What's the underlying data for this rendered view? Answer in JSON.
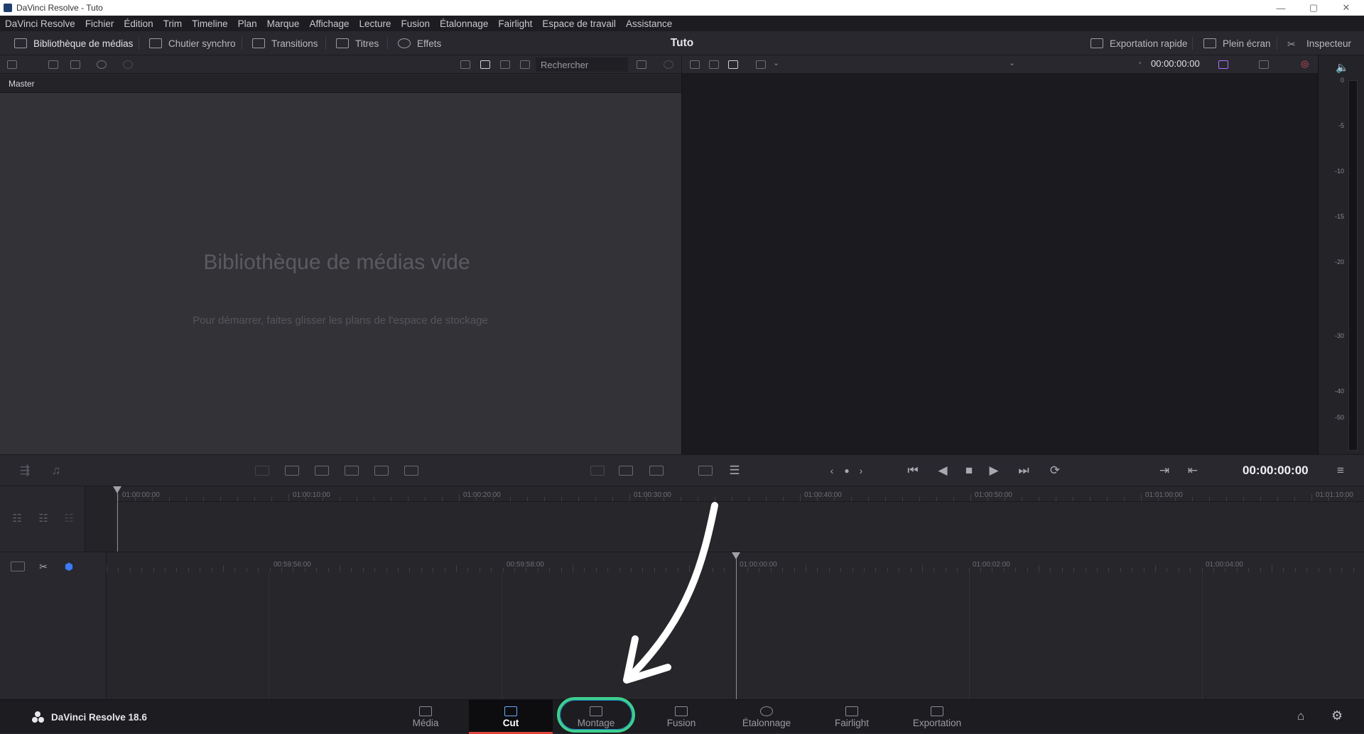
{
  "window": {
    "title": "DaVinci Resolve - Tuto",
    "minimize": "—",
    "maximize": "▢",
    "close": "✕"
  },
  "menu": [
    "DaVinci Resolve",
    "Fichier",
    "Édition",
    "Trim",
    "Timeline",
    "Plan",
    "Marque",
    "Affichage",
    "Lecture",
    "Fusion",
    "Étalonnage",
    "Fairlight",
    "Espace de travail",
    "Assistance"
  ],
  "toolbar": {
    "media_library": "Bibliothèque de médias",
    "sync_bin": "Chutier synchro",
    "transitions": "Transitions",
    "titles": "Titres",
    "effects": "Effets",
    "project_title": "Tuto",
    "quick_export": "Exportation rapide",
    "fullscreen": "Plein écran",
    "inspector": "Inspecteur"
  },
  "media_pool": {
    "search_placeholder": "Rechercher",
    "bin": "Master",
    "empty_title": "Bibliothèque de médias vide",
    "empty_subtitle": "Pour démarrer, faites glisser les plans de l'espace de stockage"
  },
  "viewer": {
    "timecode_top": "00:00:00:00",
    "timecode_main": "00:00:00:00"
  },
  "meter": {
    "labels": [
      "0",
      "-5",
      "-10",
      "-15",
      "-20",
      "-30",
      "-40",
      "-50"
    ]
  },
  "timeline_upper": {
    "ruler": [
      "01:00:00:00",
      "01:00:10:00",
      "01:00:20:00",
      "01:00:30:00",
      "01:00:40:00",
      "01:00:50:00",
      "01:01:00:00",
      "01:01:10:00"
    ]
  },
  "timeline_lower": {
    "ruler": [
      "00:59:56:00",
      "00:59:58:00",
      "01:00:00:00",
      "01:00:02:00",
      "01:00:04:00"
    ]
  },
  "pagebar": {
    "brand": "DaVinci Resolve 18.6",
    "tabs": [
      "Média",
      "Cut",
      "Montage",
      "Fusion",
      "Étalonnage",
      "Fairlight",
      "Exportation"
    ],
    "active_tab": "Cut",
    "highlighted_tab": "Montage"
  },
  "colors": {
    "highlight_ring": "#3ecf8e",
    "active_underline": "#e0443c",
    "cut_icon": "#6ea8ff"
  }
}
